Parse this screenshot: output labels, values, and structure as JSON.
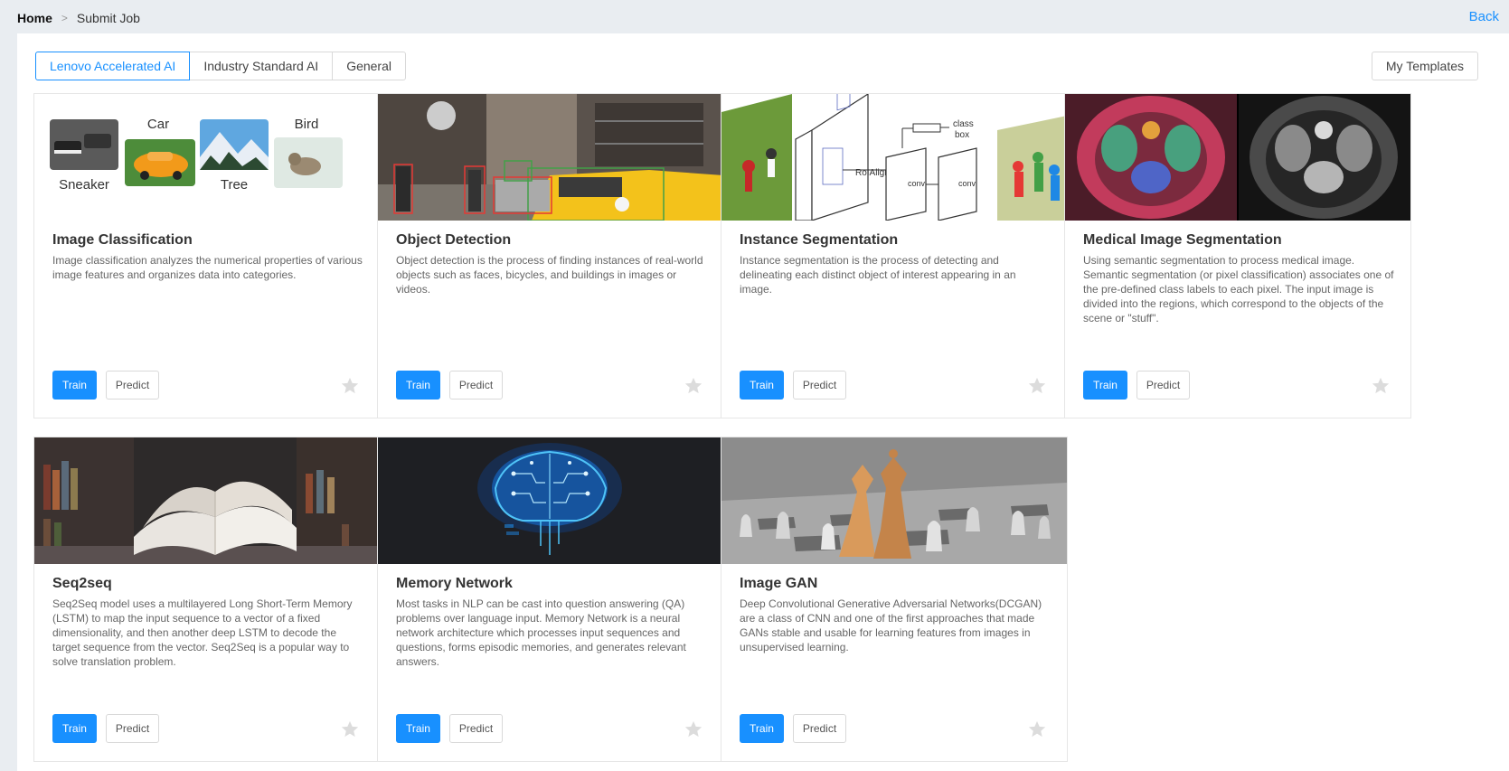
{
  "breadcrumb": {
    "home": "Home",
    "separator": ">",
    "current": "Submit Job"
  },
  "back_label": "Back",
  "tabs": [
    {
      "label": "Lenovo Accelerated AI",
      "active": true
    },
    {
      "label": "Industry Standard AI",
      "active": false
    },
    {
      "label": "General",
      "active": false
    }
  ],
  "my_templates_label": "My Templates",
  "cards": [
    {
      "title": "Image Classification",
      "description": "Image classification analyzes the numerical properties of various image features and organizes data into categories.",
      "image_labels": {
        "sneaker": "Sneaker",
        "car": "Car",
        "tree": "Tree",
        "bird": "Bird"
      },
      "train_label": "Train",
      "predict_label": "Predict"
    },
    {
      "title": "Object Detection",
      "description": "Object detection is the process of finding instances of real-world objects such as faces, bicycles, and buildings in images or videos.",
      "train_label": "Train",
      "predict_label": "Predict"
    },
    {
      "title": "Instance Segmentation",
      "description": "Instance segmentation is the process of detecting and delineating each distinct object of interest appearing in an image.",
      "image_labels": {
        "roialign": "RoIAlign",
        "conv1": "conv",
        "conv2": "conv",
        "class": "class",
        "box": "box"
      },
      "train_label": "Train",
      "predict_label": "Predict"
    },
    {
      "title": "Medical Image Segmentation",
      "description": "Using semantic segmentation to process medical image. Semantic segmentation (or pixel classification) associates one of the pre-defined class labels to each pixel. The input image is divided into the regions, which correspond to the objects of the scene or \"stuff\".",
      "train_label": "Train",
      "predict_label": "Predict"
    },
    {
      "title": "Seq2seq",
      "description": "Seq2Seq model uses a multilayered Long Short-Term Memory (LSTM) to map the input sequence to a vector of a fixed dimensionality, and then another deep LSTM to decode the target sequence from the vector. Seq2Seq is a popular way to solve translation problem.",
      "train_label": "Train",
      "predict_label": "Predict"
    },
    {
      "title": "Memory Network",
      "description": "Most tasks in NLP can be cast into question answering (QA) problems over language input. Memory Network is a neural network architecture which processes input sequences and questions, forms episodic memories, and generates relevant answers.",
      "train_label": "Train",
      "predict_label": "Predict"
    },
    {
      "title": "Image GAN",
      "description": "Deep Convolutional Generative Adversarial Networks(DCGAN) are a class of CNN and one of the first approaches that made GANs stable and usable for learning features from images in unsupervised learning.",
      "train_label": "Train",
      "predict_label": "Predict"
    }
  ],
  "colors": {
    "accent": "#1890ff",
    "star": "#dcdcdc",
    "background": "#e9edf1"
  }
}
